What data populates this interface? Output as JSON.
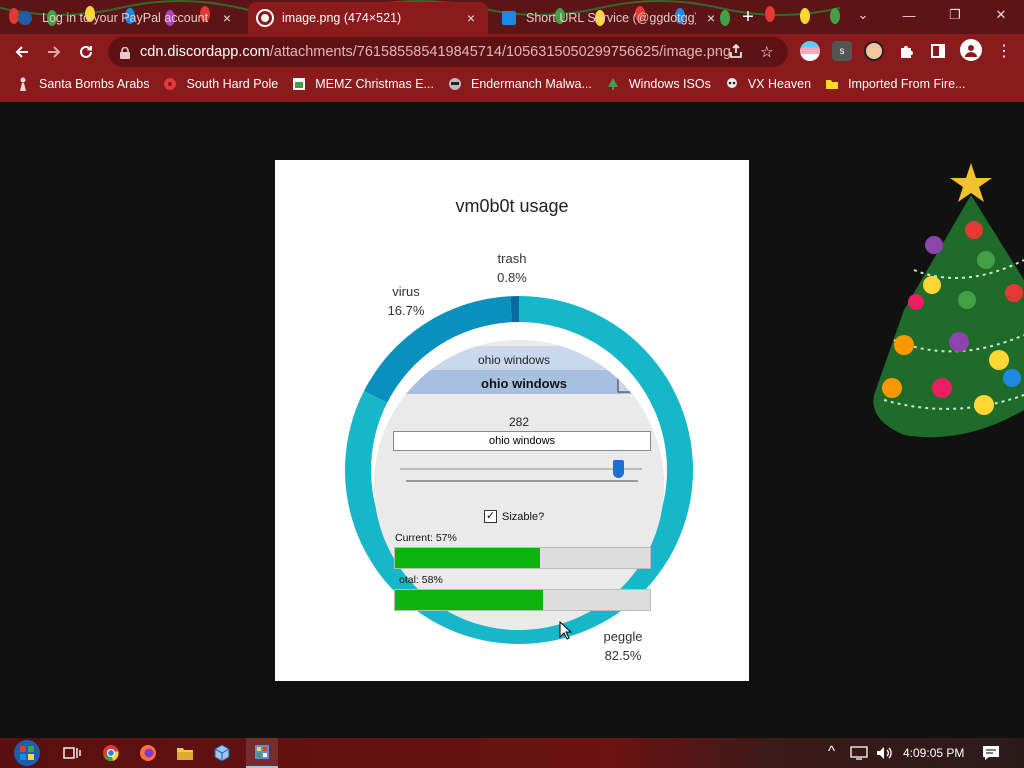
{
  "tabs": [
    {
      "title": "Log in to your PayPal account",
      "close": "×"
    },
    {
      "title": "image.png (474×521)",
      "close": "×"
    },
    {
      "title": "Short URL Service (@ggdotgg)",
      "close": "×"
    }
  ],
  "new_tab_label": "+",
  "window_controls": {
    "minimize": "—",
    "restore": "❐",
    "close": "✕",
    "dropdown": "⌄"
  },
  "address": {
    "host": "cdn.discordapp.com",
    "path": "/attachments/761585585419845714/1056315050299756625/image.png"
  },
  "extensions": [
    "",
    "s",
    "",
    "",
    "",
    ""
  ],
  "bookmarks": [
    {
      "label": "Santa Bombs Arabs"
    },
    {
      "label": "South Hard Pole"
    },
    {
      "label": "MEMZ Christmas E..."
    },
    {
      "label": "Endermanch Malwa..."
    },
    {
      "label": "Windows ISOs"
    },
    {
      "label": "VX Heaven"
    },
    {
      "label": "Imported From Fire..."
    }
  ],
  "chart_data": {
    "type": "pie",
    "title": "vm0b0t usage",
    "slices": [
      {
        "label": "trash",
        "value": 0.8,
        "display": "0.8%",
        "color": "#0b6aa0"
      },
      {
        "label": "virus",
        "value": 16.7,
        "display": "16.7%",
        "color": "#0a90bf"
      },
      {
        "label": "peggle",
        "value": 82.5,
        "display": "82.5%",
        "color": "#16b7c9"
      }
    ]
  },
  "dialog": {
    "header_small": "ohio windows",
    "header_title": "ohio windows",
    "value": "282",
    "text_value": "ohio windows",
    "slider_level": 0.92,
    "checkbox_label": "Sizable?",
    "checkbox_checked": true,
    "current_label": "Current: 57%",
    "current_pct": 0.57,
    "total_label": "otal: 58%",
    "total_pct": 0.58
  },
  "taskbar": {
    "clock": "4:09:05 PM"
  }
}
